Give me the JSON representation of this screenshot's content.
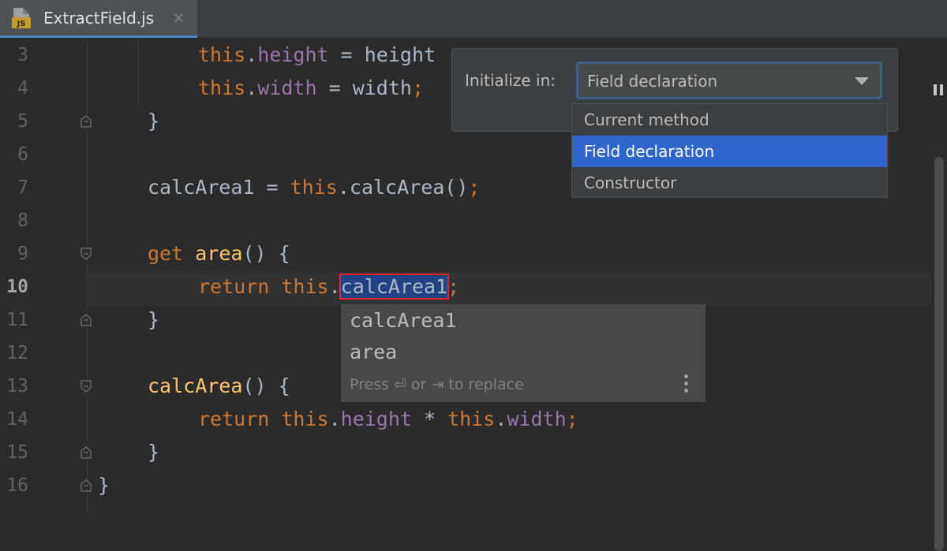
{
  "tab": {
    "title": "ExtractField.js",
    "icon_badge": "JS",
    "close": "×",
    "icon": "js-file-icon"
  },
  "code_lines": [
    {
      "num": "3",
      "indent": 2,
      "tokens": [
        {
          "t": "this",
          "c": "kw"
        },
        {
          "t": "."
        },
        {
          "t": "height",
          "c": "prop"
        },
        {
          "t": " = height"
        }
      ]
    },
    {
      "num": "4",
      "indent": 2,
      "tokens": [
        {
          "t": "this",
          "c": "kw"
        },
        {
          "t": "."
        },
        {
          "t": "width",
          "c": "prop"
        },
        {
          "t": " = width"
        },
        {
          "t": ";",
          "c": "kw"
        }
      ]
    },
    {
      "num": "5",
      "indent": 1,
      "fold": "end",
      "tokens": [
        {
          "t": "}"
        }
      ]
    },
    {
      "num": "6",
      "indent": 0,
      "tokens": []
    },
    {
      "num": "7",
      "indent": 1,
      "tokens": [
        {
          "t": "calcArea1 = "
        },
        {
          "t": "this",
          "c": "kw"
        },
        {
          "t": ".calcArea()"
        },
        {
          "t": ";",
          "c": "kw"
        }
      ]
    },
    {
      "num": "8",
      "indent": 0,
      "tokens": []
    },
    {
      "num": "9",
      "indent": 1,
      "fold": "start",
      "tokens": [
        {
          "t": "get ",
          "c": "kw"
        },
        {
          "t": "area",
          "c": "fn"
        },
        {
          "t": "() {"
        }
      ]
    },
    {
      "num": "10",
      "indent": 2,
      "active": true,
      "tokens": [
        {
          "t": "return ",
          "c": "kw"
        },
        {
          "t": "this",
          "c": "kw"
        },
        {
          "t": "."
        },
        {
          "t": "calcArea1",
          "c": "sel-id"
        },
        {
          "t": ";",
          "c": "kw"
        }
      ]
    },
    {
      "num": "11",
      "indent": 1,
      "fold": "end",
      "tokens": [
        {
          "t": "}"
        }
      ]
    },
    {
      "num": "12",
      "indent": 0,
      "tokens": []
    },
    {
      "num": "13",
      "indent": 1,
      "fold": "start",
      "tokens": [
        {
          "t": "calcArea",
          "c": "fn"
        },
        {
          "t": "() {"
        }
      ]
    },
    {
      "num": "14",
      "indent": 2,
      "tokens": [
        {
          "t": "return ",
          "c": "kw"
        },
        {
          "t": "this",
          "c": "kw"
        },
        {
          "t": "."
        },
        {
          "t": "height",
          "c": "prop"
        },
        {
          "t": " * "
        },
        {
          "t": "this",
          "c": "kw"
        },
        {
          "t": "."
        },
        {
          "t": "width",
          "c": "prop"
        },
        {
          "t": ";",
          "c": "kw"
        }
      ]
    },
    {
      "num": "15",
      "indent": 1,
      "fold": "end",
      "tokens": [
        {
          "t": "}"
        }
      ]
    },
    {
      "num": "16",
      "indent": 0,
      "fold": "end",
      "tokens": [
        {
          "t": "}"
        }
      ]
    }
  ],
  "init_popup": {
    "label": "Initialize in:",
    "selected": "Field declaration",
    "options": [
      {
        "label": "Current method",
        "selected": false
      },
      {
        "label": "Field declaration",
        "selected": true
      },
      {
        "label": "Constructor",
        "selected": false
      }
    ]
  },
  "completion": {
    "items": [
      "calcArea1",
      "area"
    ],
    "hint": "Press ⏎ or ⇥ to replace"
  },
  "colors": {
    "editor_bg": "#2b2b2b",
    "keyword": "#cc7832",
    "property": "#9876aa",
    "function": "#ffc66d",
    "selection": "#2f65ca"
  }
}
